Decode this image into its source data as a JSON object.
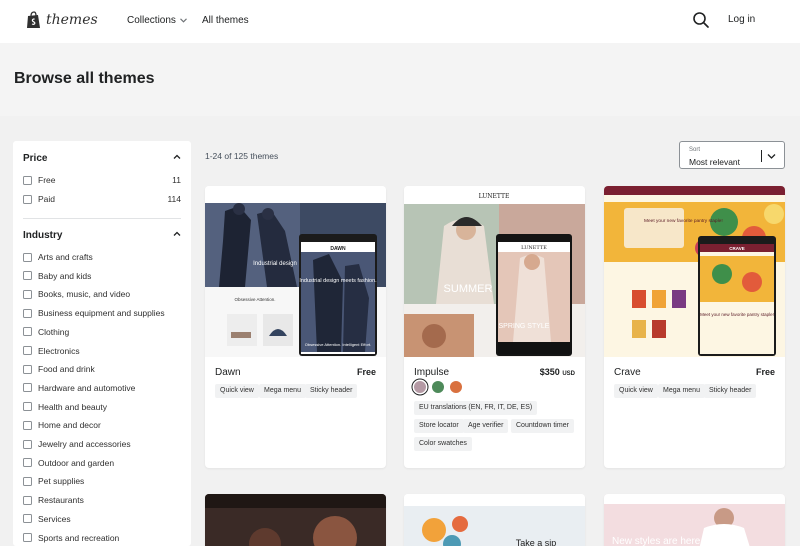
{
  "header": {
    "logo_text": "themes",
    "nav": {
      "collections": "Collections",
      "all_themes": "All themes"
    },
    "login": "Log in"
  },
  "page": {
    "title": "Browse all themes"
  },
  "filters": {
    "price": {
      "title": "Price",
      "options": [
        {
          "label": "Free",
          "count": "11"
        },
        {
          "label": "Paid",
          "count": "114"
        }
      ]
    },
    "industry": {
      "title": "Industry",
      "options": [
        {
          "label": "Arts and crafts"
        },
        {
          "label": "Baby and kids"
        },
        {
          "label": "Books, music, and video"
        },
        {
          "label": "Business equipment and supplies"
        },
        {
          "label": "Clothing"
        },
        {
          "label": "Electronics"
        },
        {
          "label": "Food and drink"
        },
        {
          "label": "Hardware and automotive"
        },
        {
          "label": "Health and beauty"
        },
        {
          "label": "Home and decor"
        },
        {
          "label": "Jewelry and accessories"
        },
        {
          "label": "Outdoor and garden"
        },
        {
          "label": "Pet supplies"
        },
        {
          "label": "Restaurants"
        },
        {
          "label": "Services"
        },
        {
          "label": "Sports and recreation"
        }
      ]
    }
  },
  "results": {
    "count_text": "1-24 of 125 themes"
  },
  "sort": {
    "label": "Sort",
    "value": "Most relevant"
  },
  "themes": [
    {
      "name": "Dawn",
      "price": "Free",
      "currency": "",
      "tags": [
        "Quick view",
        "Mega menu",
        "Sticky header"
      ],
      "preview_texts": [
        "DAWN",
        "Industrial design",
        "Industrial design meets fashion.",
        "Obsessive Attention.",
        "Obsessive Attention. Intelligent Effort."
      ]
    },
    {
      "name": "Impulse",
      "price": "$350",
      "currency": "USD",
      "swatch_colors": [
        "#b59aa5",
        "#4e8a5a",
        "#d9713f"
      ],
      "tags": [
        "EU translations (EN, FR, IT, DE, ES)",
        "Store locator",
        "Age verifier",
        "Countdown timer",
        "Color swatches"
      ],
      "preview_texts": [
        "LUNETTE",
        "SUMMER",
        "SPRING STYLE",
        "LUNETTE"
      ]
    },
    {
      "name": "Crave",
      "price": "Free",
      "currency": "",
      "tags": [
        "Quick view",
        "Mega menu",
        "Sticky header"
      ],
      "preview_texts": [
        "Meet your new favorite pantry staple!",
        "Meet your new favorite pantry staple!",
        "CRAVE"
      ]
    }
  ],
  "second_row_previews": [
    "Take a sip",
    "New styles are here"
  ],
  "colors": {
    "accent": "#202223",
    "background": "#f4f4f4",
    "card": "#ffffff"
  }
}
